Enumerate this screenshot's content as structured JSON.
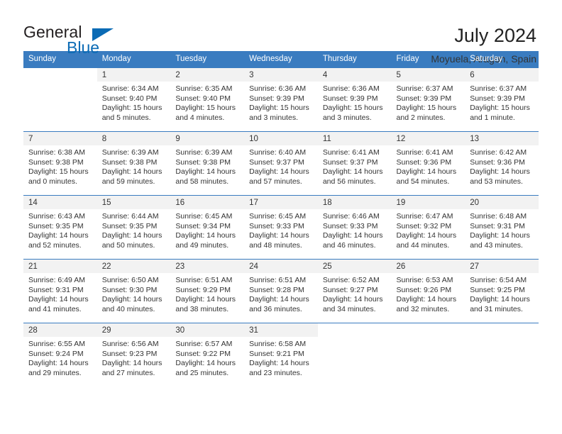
{
  "brand": {
    "name_part1": "General",
    "name_part2": "Blue",
    "triangle_icon": "triangle-icon",
    "accent_color": "#0b6bb5"
  },
  "header": {
    "title": "July 2024",
    "subtitle": "Moyuela, Aragon, Spain"
  },
  "calendar": {
    "header_bg": "#3a7cc0",
    "daynum_bg": "#f2f2f2",
    "weekdays": [
      "Sunday",
      "Monday",
      "Tuesday",
      "Wednesday",
      "Thursday",
      "Friday",
      "Saturday"
    ],
    "weeks": [
      [
        {
          "day": "",
          "sunrise": "",
          "sunset": "",
          "daylight1": "",
          "daylight2": "",
          "empty": true
        },
        {
          "day": "1",
          "sunrise": "Sunrise: 6:34 AM",
          "sunset": "Sunset: 9:40 PM",
          "daylight1": "Daylight: 15 hours",
          "daylight2": "and 5 minutes."
        },
        {
          "day": "2",
          "sunrise": "Sunrise: 6:35 AM",
          "sunset": "Sunset: 9:40 PM",
          "daylight1": "Daylight: 15 hours",
          "daylight2": "and 4 minutes."
        },
        {
          "day": "3",
          "sunrise": "Sunrise: 6:36 AM",
          "sunset": "Sunset: 9:39 PM",
          "daylight1": "Daylight: 15 hours",
          "daylight2": "and 3 minutes."
        },
        {
          "day": "4",
          "sunrise": "Sunrise: 6:36 AM",
          "sunset": "Sunset: 9:39 PM",
          "daylight1": "Daylight: 15 hours",
          "daylight2": "and 3 minutes."
        },
        {
          "day": "5",
          "sunrise": "Sunrise: 6:37 AM",
          "sunset": "Sunset: 9:39 PM",
          "daylight1": "Daylight: 15 hours",
          "daylight2": "and 2 minutes."
        },
        {
          "day": "6",
          "sunrise": "Sunrise: 6:37 AM",
          "sunset": "Sunset: 9:39 PM",
          "daylight1": "Daylight: 15 hours",
          "daylight2": "and 1 minute."
        }
      ],
      [
        {
          "day": "7",
          "sunrise": "Sunrise: 6:38 AM",
          "sunset": "Sunset: 9:38 PM",
          "daylight1": "Daylight: 15 hours",
          "daylight2": "and 0 minutes."
        },
        {
          "day": "8",
          "sunrise": "Sunrise: 6:39 AM",
          "sunset": "Sunset: 9:38 PM",
          "daylight1": "Daylight: 14 hours",
          "daylight2": "and 59 minutes."
        },
        {
          "day": "9",
          "sunrise": "Sunrise: 6:39 AM",
          "sunset": "Sunset: 9:38 PM",
          "daylight1": "Daylight: 14 hours",
          "daylight2": "and 58 minutes."
        },
        {
          "day": "10",
          "sunrise": "Sunrise: 6:40 AM",
          "sunset": "Sunset: 9:37 PM",
          "daylight1": "Daylight: 14 hours",
          "daylight2": "and 57 minutes."
        },
        {
          "day": "11",
          "sunrise": "Sunrise: 6:41 AM",
          "sunset": "Sunset: 9:37 PM",
          "daylight1": "Daylight: 14 hours",
          "daylight2": "and 56 minutes."
        },
        {
          "day": "12",
          "sunrise": "Sunrise: 6:41 AM",
          "sunset": "Sunset: 9:36 PM",
          "daylight1": "Daylight: 14 hours",
          "daylight2": "and 54 minutes."
        },
        {
          "day": "13",
          "sunrise": "Sunrise: 6:42 AM",
          "sunset": "Sunset: 9:36 PM",
          "daylight1": "Daylight: 14 hours",
          "daylight2": "and 53 minutes."
        }
      ],
      [
        {
          "day": "14",
          "sunrise": "Sunrise: 6:43 AM",
          "sunset": "Sunset: 9:35 PM",
          "daylight1": "Daylight: 14 hours",
          "daylight2": "and 52 minutes."
        },
        {
          "day": "15",
          "sunrise": "Sunrise: 6:44 AM",
          "sunset": "Sunset: 9:35 PM",
          "daylight1": "Daylight: 14 hours",
          "daylight2": "and 50 minutes."
        },
        {
          "day": "16",
          "sunrise": "Sunrise: 6:45 AM",
          "sunset": "Sunset: 9:34 PM",
          "daylight1": "Daylight: 14 hours",
          "daylight2": "and 49 minutes."
        },
        {
          "day": "17",
          "sunrise": "Sunrise: 6:45 AM",
          "sunset": "Sunset: 9:33 PM",
          "daylight1": "Daylight: 14 hours",
          "daylight2": "and 48 minutes."
        },
        {
          "day": "18",
          "sunrise": "Sunrise: 6:46 AM",
          "sunset": "Sunset: 9:33 PM",
          "daylight1": "Daylight: 14 hours",
          "daylight2": "and 46 minutes."
        },
        {
          "day": "19",
          "sunrise": "Sunrise: 6:47 AM",
          "sunset": "Sunset: 9:32 PM",
          "daylight1": "Daylight: 14 hours",
          "daylight2": "and 44 minutes."
        },
        {
          "day": "20",
          "sunrise": "Sunrise: 6:48 AM",
          "sunset": "Sunset: 9:31 PM",
          "daylight1": "Daylight: 14 hours",
          "daylight2": "and 43 minutes."
        }
      ],
      [
        {
          "day": "21",
          "sunrise": "Sunrise: 6:49 AM",
          "sunset": "Sunset: 9:31 PM",
          "daylight1": "Daylight: 14 hours",
          "daylight2": "and 41 minutes."
        },
        {
          "day": "22",
          "sunrise": "Sunrise: 6:50 AM",
          "sunset": "Sunset: 9:30 PM",
          "daylight1": "Daylight: 14 hours",
          "daylight2": "and 40 minutes."
        },
        {
          "day": "23",
          "sunrise": "Sunrise: 6:51 AM",
          "sunset": "Sunset: 9:29 PM",
          "daylight1": "Daylight: 14 hours",
          "daylight2": "and 38 minutes."
        },
        {
          "day": "24",
          "sunrise": "Sunrise: 6:51 AM",
          "sunset": "Sunset: 9:28 PM",
          "daylight1": "Daylight: 14 hours",
          "daylight2": "and 36 minutes."
        },
        {
          "day": "25",
          "sunrise": "Sunrise: 6:52 AM",
          "sunset": "Sunset: 9:27 PM",
          "daylight1": "Daylight: 14 hours",
          "daylight2": "and 34 minutes."
        },
        {
          "day": "26",
          "sunrise": "Sunrise: 6:53 AM",
          "sunset": "Sunset: 9:26 PM",
          "daylight1": "Daylight: 14 hours",
          "daylight2": "and 32 minutes."
        },
        {
          "day": "27",
          "sunrise": "Sunrise: 6:54 AM",
          "sunset": "Sunset: 9:25 PM",
          "daylight1": "Daylight: 14 hours",
          "daylight2": "and 31 minutes."
        }
      ],
      [
        {
          "day": "28",
          "sunrise": "Sunrise: 6:55 AM",
          "sunset": "Sunset: 9:24 PM",
          "daylight1": "Daylight: 14 hours",
          "daylight2": "and 29 minutes."
        },
        {
          "day": "29",
          "sunrise": "Sunrise: 6:56 AM",
          "sunset": "Sunset: 9:23 PM",
          "daylight1": "Daylight: 14 hours",
          "daylight2": "and 27 minutes."
        },
        {
          "day": "30",
          "sunrise": "Sunrise: 6:57 AM",
          "sunset": "Sunset: 9:22 PM",
          "daylight1": "Daylight: 14 hours",
          "daylight2": "and 25 minutes."
        },
        {
          "day": "31",
          "sunrise": "Sunrise: 6:58 AM",
          "sunset": "Sunset: 9:21 PM",
          "daylight1": "Daylight: 14 hours",
          "daylight2": "and 23 minutes."
        },
        {
          "day": "",
          "sunrise": "",
          "sunset": "",
          "daylight1": "",
          "daylight2": "",
          "empty": true
        },
        {
          "day": "",
          "sunrise": "",
          "sunset": "",
          "daylight1": "",
          "daylight2": "",
          "empty": true
        },
        {
          "day": "",
          "sunrise": "",
          "sunset": "",
          "daylight1": "",
          "daylight2": "",
          "empty": true
        }
      ]
    ]
  }
}
